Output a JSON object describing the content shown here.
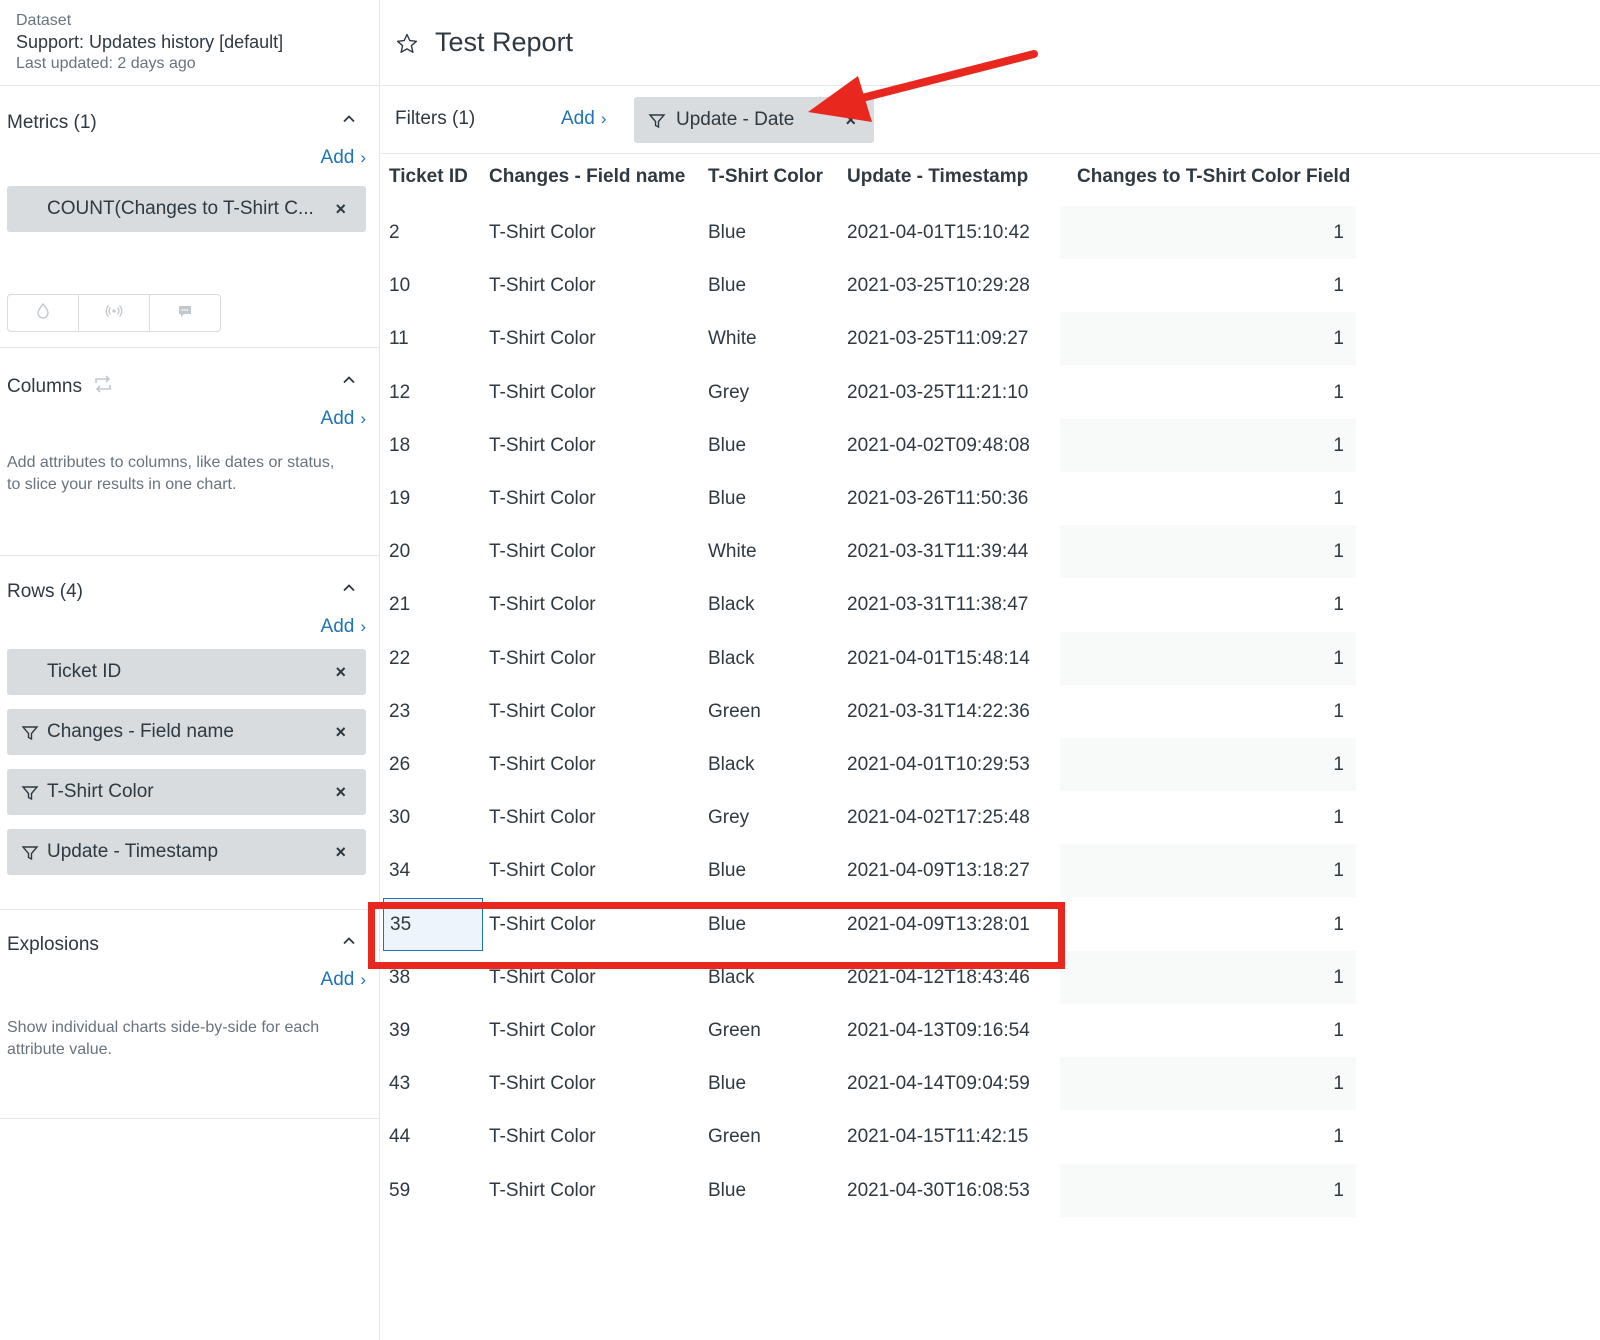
{
  "dataset": {
    "label": "Dataset",
    "name": "Support: Updates history [default]",
    "last_updated": "Last updated: 2 days ago"
  },
  "metrics": {
    "title": "Metrics (1)",
    "add_label": "Add",
    "items": [
      {
        "label": "COUNT(Changes to T-Shirt C..."
      }
    ]
  },
  "columns": {
    "title": "Columns",
    "add_label": "Add",
    "hint": "Add attributes to columns, like dates or status, to slice your results in one chart."
  },
  "rows": {
    "title": "Rows (4)",
    "add_label": "Add",
    "items": [
      {
        "label": "Ticket ID",
        "filter_icon": false
      },
      {
        "label": "Changes - Field name",
        "filter_icon": true
      },
      {
        "label": "T-Shirt Color",
        "filter_icon": true
      },
      {
        "label": "Update - Timestamp",
        "filter_icon": true
      }
    ]
  },
  "explosions": {
    "title": "Explosions",
    "add_label": "Add",
    "hint": "Show individual charts side-by-side for each attribute value."
  },
  "report": {
    "title": "Test Report"
  },
  "filters": {
    "label": "Filters (1)",
    "add_label": "Add",
    "items": [
      {
        "label": "Update - Date"
      }
    ]
  },
  "table": {
    "headers": [
      "Ticket ID",
      "Changes - Field name",
      "T-Shirt Color",
      "Update - Timestamp",
      "Changes to T-Shirt Color Field"
    ],
    "rows": [
      [
        "2",
        "T-Shirt Color",
        "Blue",
        "2021-04-01T15:10:42",
        "1"
      ],
      [
        "10",
        "T-Shirt Color",
        "Blue",
        "2021-03-25T10:29:28",
        "1"
      ],
      [
        "11",
        "T-Shirt Color",
        "White",
        "2021-03-25T11:09:27",
        "1"
      ],
      [
        "12",
        "T-Shirt Color",
        "Grey",
        "2021-03-25T11:21:10",
        "1"
      ],
      [
        "18",
        "T-Shirt Color",
        "Blue",
        "2021-04-02T09:48:08",
        "1"
      ],
      [
        "19",
        "T-Shirt Color",
        "Blue",
        "2021-03-26T11:50:36",
        "1"
      ],
      [
        "20",
        "T-Shirt Color",
        "White",
        "2021-03-31T11:39:44",
        "1"
      ],
      [
        "21",
        "T-Shirt Color",
        "Black",
        "2021-03-31T11:38:47",
        "1"
      ],
      [
        "22",
        "T-Shirt Color",
        "Black",
        "2021-04-01T15:48:14",
        "1"
      ],
      [
        "23",
        "T-Shirt Color",
        "Green",
        "2021-03-31T14:22:36",
        "1"
      ],
      [
        "26",
        "T-Shirt Color",
        "Black",
        "2021-04-01T10:29:53",
        "1"
      ],
      [
        "30",
        "T-Shirt Color",
        "Grey",
        "2021-04-02T17:25:48",
        "1"
      ],
      [
        "34",
        "T-Shirt Color",
        "Blue",
        "2021-04-09T13:18:27",
        "1"
      ],
      [
        "35",
        "T-Shirt Color",
        "Blue",
        "2021-04-09T13:28:01",
        "1"
      ],
      [
        "38",
        "T-Shirt Color",
        "Black",
        "2021-04-12T18:43:46",
        "1"
      ],
      [
        "39",
        "T-Shirt Color",
        "Green",
        "2021-04-13T09:16:54",
        "1"
      ],
      [
        "43",
        "T-Shirt Color",
        "Blue",
        "2021-04-14T09:04:59",
        "1"
      ],
      [
        "44",
        "T-Shirt Color",
        "Green",
        "2021-04-15T11:42:15",
        "1"
      ],
      [
        "59",
        "T-Shirt Color",
        "Blue",
        "2021-04-30T16:08:53",
        "1"
      ]
    ],
    "selected_row": 13
  },
  "colors": {
    "link": "#1f73b7",
    "pill_bg": "#d8dcde",
    "annotation_red": "#e8281e"
  }
}
